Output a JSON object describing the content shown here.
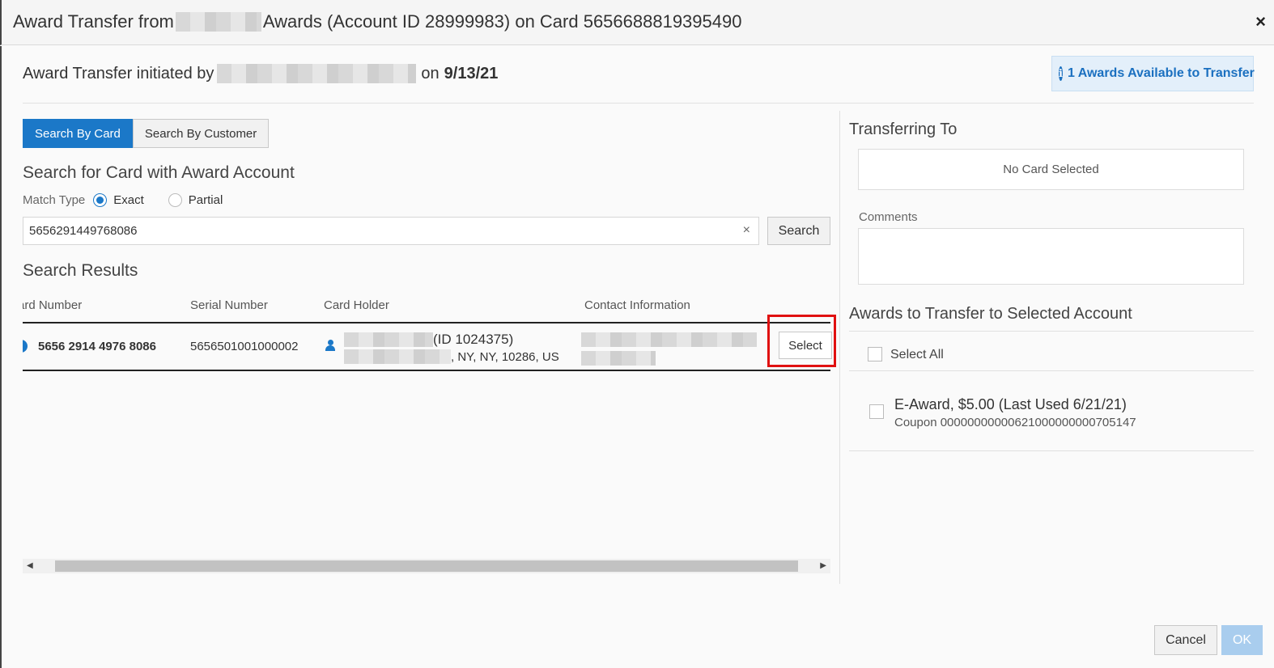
{
  "dialog": {
    "title_prefix": "Award Transfer from",
    "title_suffix": "Awards (Account ID 28999983) on Card 5656688819395490",
    "close_label": "×"
  },
  "header": {
    "initiated_prefix": "Award Transfer initiated by",
    "initiated_on": "on",
    "initiated_date": "9/13/21",
    "available_badge": "1 Awards Available to Transfer",
    "info_icon": "i"
  },
  "search": {
    "tabs": [
      {
        "label": "Search By Card",
        "active": true
      },
      {
        "label": "Search By Customer",
        "active": false
      }
    ],
    "heading": "Search for Card with Award Account",
    "match_type_label": "Match Type",
    "match_options": [
      {
        "label": "Exact",
        "selected": true
      },
      {
        "label": "Partial",
        "selected": false
      }
    ],
    "input_value": "5656291449768086",
    "clear_label": "×",
    "search_button": "Search"
  },
  "results": {
    "heading": "Search Results",
    "columns": [
      "ard Number",
      "Serial Number",
      "Card Holder",
      "Contact Information"
    ],
    "rows": [
      {
        "card_number": "5656 2914 4976 8086",
        "serial_number": "5656501001000002",
        "holder_id": "(ID 1024375)",
        "holder_address": ", NY, NY, 10286, US",
        "select_label": "Select"
      }
    ]
  },
  "right_panel": {
    "transferring_to": "Transferring To",
    "no_card": "No Card Selected",
    "comments_label": "Comments",
    "awards_heading": "Awards to Transfer to Selected Account",
    "select_all": "Select All",
    "awards": [
      {
        "title": "E-Award, $5.00 (Last Used 6/21/21)",
        "subtitle": "Coupon 00000000000621000000000705147"
      }
    ]
  },
  "footer": {
    "cancel": "Cancel",
    "ok": "OK"
  },
  "colors": {
    "accent": "#1b78c8",
    "highlight": "#e01010"
  }
}
